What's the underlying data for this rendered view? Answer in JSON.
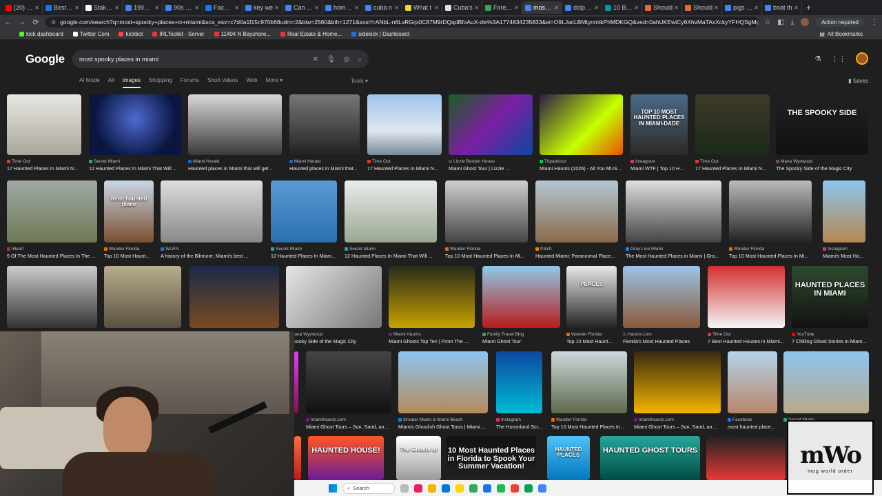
{
  "browser": {
    "tabs": [
      {
        "label": "(20) Ho",
        "color": "#ff0000"
      },
      {
        "label": "Best Hi",
        "color": "#1a73e8"
      },
      {
        "label": "Stake.u",
        "color": "#ffffff"
      },
      {
        "label": "1995 je",
        "color": "#4285f4"
      },
      {
        "label": "90s sta",
        "color": "#4285f4"
      },
      {
        "label": "Facebo",
        "color": "#1877f2"
      },
      {
        "label": "key we",
        "color": "#4285f4"
      },
      {
        "label": "Can u S",
        "color": "#4285f4"
      },
      {
        "label": "homele",
        "color": "#4285f4"
      },
      {
        "label": "cuba n",
        "color": "#4285f4"
      },
      {
        "label": "What t",
        "color": "#f4d03f"
      },
      {
        "label": "Cuba's",
        "color": "#e0e0e0"
      },
      {
        "label": "Foreign",
        "color": "#34a853"
      },
      {
        "label": "most sp",
        "color": "#4285f4"
      },
      {
        "label": "dolphin",
        "color": "#4285f4"
      },
      {
        "label": "10 Best",
        "color": "#0097a7"
      },
      {
        "label": "Should",
        "color": "#e86a2b"
      },
      {
        "label": "Should",
        "color": "#e86a2b"
      },
      {
        "label": "pigs sw",
        "color": "#4285f4"
      },
      {
        "label": "boat th",
        "color": "#4285f4"
      }
    ],
    "active_tab_index": 13,
    "url": "google.com/search?q=most+spooky+places+in+miami&sca_esv=c7d0a1f15c970b68udm=2&biw=2560&bih=1271&sxsrf=ANbL-n6LvRGrp0C87M9rDQqdBfoAuX-dw%3A1774834235833&ei=O9LJacLBMtynmtkPhMDKGQ&ved=0ahUKEwiCy6XhvMaTAxXckyYFHQSgMgMQ4dUDCBI&uact=5&oq=most+spooky+places+in+mia...",
    "action_required": "Action required",
    "bookmarks": [
      {
        "label": "kick dashboard",
        "color": "#53fc18"
      },
      {
        "label": "Twitter Com",
        "color": "#ffffff"
      },
      {
        "label": "kickbot",
        "color": "#ff4444"
      },
      {
        "label": "IRLToolkit - Server",
        "color": "#e53935"
      },
      {
        "label": "11404 N Bayshore...",
        "color": "#e53935"
      },
      {
        "label": "Real Estate & Home...",
        "color": "#e53935"
      },
      {
        "label": "sidekick | Dashboard",
        "color": "#1a73e8"
      }
    ],
    "all_bookmarks": "All Bookmarks"
  },
  "google": {
    "logo": "Google",
    "query": "most spooky places in miami",
    "nav": [
      "AI Mode",
      "All",
      "Images",
      "Shopping",
      "Forums",
      "Short videos",
      "Web",
      "More"
    ],
    "active_nav": "Images",
    "tools": "Tools",
    "saves": "Saves"
  },
  "results": [
    {
      "src": "Time Out",
      "cap": "17 Haunted Places In Miami N...",
      "sc": "#e53935",
      "bg": "linear-gradient(180deg,#e8e8e2,#a9a59c)",
      "ov": ""
    },
    {
      "src": "Secret Miami",
      "cap": "12 Haunted Places In Miami That Will ...",
      "sc": "#26a69a",
      "bg": "radial-gradient(circle at 50% 40%,#4d6bd1,#0a1540 70%)",
      "ov": ""
    },
    {
      "src": "Miami Herald",
      "cap": "Haunted places in Miami that will get ...",
      "sc": "#1565c0",
      "bg": "linear-gradient(180deg,#d8d8d8,#3a3a3a)",
      "ov": ""
    },
    {
      "src": "Miami Herald",
      "cap": "Haunted places in Miami that...",
      "sc": "#1565c0",
      "bg": "linear-gradient(180deg,#777,#222)",
      "ov": ""
    },
    {
      "src": "Time Out",
      "cap": "17 Haunted Places In Miami N...",
      "sc": "#e53935",
      "bg": "linear-gradient(180deg,#9fc4ef,#dfe7ef 60%,#7a8a9a)",
      "ov": ""
    },
    {
      "src": "Lizzie Borden House",
      "cap": "Miami Ghost Tour | Lizzie ...",
      "sc": "#5d4037",
      "bg": "linear-gradient(135deg,#1b5e20,#7b1fa2 50%,#0d47a1)",
      "ov": ""
    },
    {
      "src": "Tripadvisor",
      "cap": "Miami Haunts (2026) - All You MUS...",
      "sc": "#00c853",
      "bg": "linear-gradient(135deg,#2e1a47,#c6ff00 60%,#e65100)",
      "ov": ""
    },
    {
      "src": "Instagram",
      "cap": "Miami WTF | Top 10 H...",
      "sc": "#e1306c",
      "bg": "linear-gradient(180deg,#4a6a8a,#2d2a24)",
      "ov": "TOP 10 MOST HAUNTED PLACES IN MIAMI-DADE"
    },
    {
      "src": "Time Out",
      "cap": "17 Haunted Places In Miami N...",
      "sc": "#e53935",
      "bg": "linear-gradient(180deg,#3e3a2a,#1b2a18)",
      "ov": ""
    },
    {
      "src": "Mana Wynwood",
      "cap": "The Spooky Side of the Magic City",
      "sc": "#795548",
      "bg": "linear-gradient(180deg,#222,#111)",
      "ov": "THE SPOOKY SIDE"
    },
    {
      "src": "iHeart",
      "cap": "5 Of The Most Haunted Places In The ...",
      "sc": "#c62828",
      "bg": "linear-gradient(180deg,#a0a8a4,#6d7a55)",
      "ov": ""
    },
    {
      "src": "Wander Florida",
      "cap": "Top 10 Most Haunt...",
      "sc": "#ef6c00",
      "bg": "linear-gradient(180deg,#c9d6e6,#7a5030)",
      "ov": "most haunted place"
    },
    {
      "src": "WLRN",
      "cap": "A history of the Biltmore, Miami's best ...",
      "sc": "#1976d2",
      "bg": "linear-gradient(180deg,#ddd,#888)",
      "ov": ""
    },
    {
      "src": "Secret Miami",
      "cap": "12 Haunted Places In Miami ...",
      "sc": "#26a69a",
      "bg": "linear-gradient(180deg,#5b9bd5,#2a6fb0)",
      "ov": ""
    },
    {
      "src": "Secret Miami",
      "cap": "12 Haunted Places In Miami That Will ...",
      "sc": "#26a69a",
      "bg": "linear-gradient(180deg,#e9ecef,#9aa690)",
      "ov": ""
    },
    {
      "src": "Wander Florida",
      "cap": "Top 10 Most Haunted Places In Mi...",
      "sc": "#ef6c00",
      "bg": "linear-gradient(180deg,#cfcfcf,#444)",
      "ov": ""
    },
    {
      "src": "Patch",
      "cap": "Haunted Miami: Paranormal Place...",
      "sc": "#f57c00",
      "bg": "linear-gradient(180deg,#b3c7d6,#8a6a4a)",
      "ov": ""
    },
    {
      "src": "Gray Line Miami",
      "cap": "The Most Haunted Places in Miami | Gra...",
      "sc": "#1e88e5",
      "bg": "linear-gradient(180deg,#e0e0e0,#444)",
      "ov": ""
    },
    {
      "src": "Wander Florida",
      "cap": "Top 10 Most Haunted Places In Mi...",
      "sc": "#ef6c00",
      "bg": "linear-gradient(180deg,#bbb,#222)",
      "ov": ""
    },
    {
      "src": "Instagram",
      "cap": "Miami's Most Haun...",
      "sc": "#e1306c",
      "bg": "linear-gradient(180deg,#8ec5f0,#b5884f)",
      "ov": ""
    },
    {
      "src": "",
      "cap": "",
      "sc": "#555",
      "bg": "linear-gradient(180deg,#ccc,#333)",
      "ov": ""
    },
    {
      "src": "",
      "cap": "",
      "sc": "#555",
      "bg": "linear-gradient(180deg,#b9ad8e,#5a5040)",
      "ov": ""
    },
    {
      "src": "",
      "cap": "",
      "sc": "#555",
      "bg": "linear-gradient(180deg,#1a2a4a,#7a4a20)",
      "ov": ""
    },
    {
      "src": "Mana Wynwood",
      "cap": "e Spooky Side of the Magic City",
      "sc": "#795548",
      "bg": "linear-gradient(135deg,#e6e6e6,#777)",
      "ov": ""
    },
    {
      "src": "Miami Haunts",
      "cap": "Miami Ghosts Top Ten | From The ...",
      "sc": "#6a1b9a",
      "bg": "linear-gradient(180deg,#2a2a1a,#c6a200)",
      "ov": ""
    },
    {
      "src": "Family Travel Blog",
      "cap": "Miami Ghost Tour",
      "sc": "#43a047",
      "bg": "linear-gradient(180deg,#8ecae6,#b71c1c)",
      "ov": ""
    },
    {
      "src": "Wander Florida",
      "cap": "Top 10 Most Haunt...",
      "sc": "#ef6c00",
      "bg": "linear-gradient(180deg,#e9e9e9,#222)",
      "ov": "PLACES"
    },
    {
      "src": "Haunts.com",
      "cap": "Florida's Most Haunted Places",
      "sc": "#37474f",
      "bg": "linear-gradient(180deg,#9cc4e8,#8a5a3a)",
      "ov": ""
    },
    {
      "src": "Time Out",
      "cap": "7 Best Haunted Houses in Miami...",
      "sc": "#e53935",
      "bg": "linear-gradient(180deg,#d32f2f,#f5f5f5)",
      "ov": ""
    },
    {
      "src": "YouTube",
      "cap": "7 Chilling Ghost Stories in Miam...",
      "sc": "#ff0000",
      "bg": "linear-gradient(180deg,#2e4a2e,#111)",
      "ov": "HAUNTED PLACES IN MIAMI"
    },
    {
      "src": "",
      "cap": "",
      "sc": "#555",
      "bg": "linear-gradient(180deg,#e040fb,#880e4f)",
      "ov": ""
    },
    {
      "src": "miamihaunts.com",
      "cap": "Miami Ghost Tours – Sun, Sand, an...",
      "sc": "#6a1b9a",
      "bg": "linear-gradient(180deg,#444,#111)",
      "ov": ""
    },
    {
      "src": "Greater Miami & Miami Beach",
      "cap": "Miamis Ghoulish Ghost Tours | Miami ...",
      "sc": "#0288d1",
      "bg": "linear-gradient(180deg,#8ec5f0,#b58a5a)",
      "ov": ""
    },
    {
      "src": "Instagram",
      "cap": "The Horrorland Scr...",
      "sc": "#e1306c",
      "bg": "linear-gradient(180deg,#0d47a1,#00bcd4)",
      "ov": ""
    },
    {
      "src": "Wander Florida",
      "cap": "Top 10 Most Haunted Places In...",
      "sc": "#ef6c00",
      "bg": "linear-gradient(180deg,#cfd8dc,#5d6a4a)",
      "ov": ""
    },
    {
      "src": "miamihaunts.com",
      "cap": "Miami Ghost Tours – Sun, Sand, an...",
      "sc": "#6a1b9a",
      "bg": "linear-gradient(180deg,#3a2a10,#f5b400)",
      "ov": ""
    },
    {
      "src": "Facebook",
      "cap": "most haunted place...",
      "sc": "#1877f2",
      "bg": "linear-gradient(180deg,#b3d4ec,#b8866a)",
      "ov": ""
    },
    {
      "src": "Secret Miami",
      "cap": "",
      "sc": "#26a69a",
      "bg": "linear-gradient(180deg,#8ec5f0,#b8a88a)",
      "ov": ""
    },
    {
      "src": "",
      "cap": "",
      "sc": "#555",
      "bg": "linear-gradient(180deg,#ff7043,#b71c1c)",
      "ov": ""
    },
    {
      "src": "",
      "cap": "",
      "sc": "#555",
      "bg": "linear-gradient(180deg,#ff5722,#6a1b9a)",
      "ov": "HAUNTED HOUSE!"
    },
    {
      "src": "",
      "cap": "",
      "sc": "#555",
      "bg": "linear-gradient(180deg,#ffffff,#999)",
      "ov": "The Ghosts of"
    },
    {
      "src": "",
      "cap": "",
      "sc": "#555",
      "bg": "linear-gradient(180deg,#111,#222)",
      "ov": "10 Most Haunted Places in Florida to Spook Your Summer Vacation!"
    },
    {
      "src": "",
      "cap": "",
      "sc": "#555",
      "bg": "linear-gradient(180deg,#4fc3f7,#0277bd)",
      "ov": "HAUNTED PLACES"
    },
    {
      "src": "",
      "cap": "",
      "sc": "#555",
      "bg": "linear-gradient(180deg,#26a69a,#004d40)",
      "ov": "HAUNTED GHOST TOURS"
    },
    {
      "src": "",
      "cap": "",
      "sc": "#555",
      "bg": "linear-gradient(180deg,#222,#e53935)",
      "ov": ""
    }
  ],
  "taskbar": {
    "search": "Search"
  },
  "stamp": {
    "big": "mWo",
    "sub": "mog world order"
  }
}
